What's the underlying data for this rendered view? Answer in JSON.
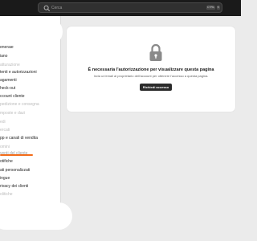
{
  "search": {
    "placeholder": "Cerca",
    "shortcut_key1": "CTRL",
    "shortcut_key2": "K"
  },
  "sidebar": {
    "items": [
      {
        "label": "enerale",
        "state": "normal"
      },
      {
        "label": "iano",
        "state": "normal"
      },
      {
        "label": "atturazione",
        "state": "muted"
      },
      {
        "label": "tenti e autorizzazioni",
        "state": "normal"
      },
      {
        "label": "agamenti",
        "state": "normal"
      },
      {
        "label": "heck-out",
        "state": "normal"
      },
      {
        "label": "ccount cliente",
        "state": "normal"
      },
      {
        "label": "pedizione e consegna",
        "state": "muted"
      },
      {
        "label": "mposte e dazi",
        "state": "muted"
      },
      {
        "label": "edi",
        "state": "muted"
      },
      {
        "label": "ercati",
        "state": "muted"
      },
      {
        "label": "pp e canali di vendita",
        "state": "normal"
      },
      {
        "label": "omini",
        "state": "muted"
      },
      {
        "label": "venti del cliente",
        "state": "active"
      },
      {
        "label": "otifiche",
        "state": "normal"
      },
      {
        "label": "ati personalizzati",
        "state": "normal"
      },
      {
        "label": "ingue",
        "state": "normal"
      },
      {
        "label": "rivacy dei clienti",
        "state": "normal"
      },
      {
        "label": "olitiche",
        "state": "muted"
      }
    ]
  },
  "main": {
    "title": "È necessaria l'autorizzazione per visualizzare questa pagina",
    "description": "Invia un'email al proprietario dell'account per ottenere l'accesso a questa pagina.",
    "button_label": "Richiedi accesso"
  }
}
